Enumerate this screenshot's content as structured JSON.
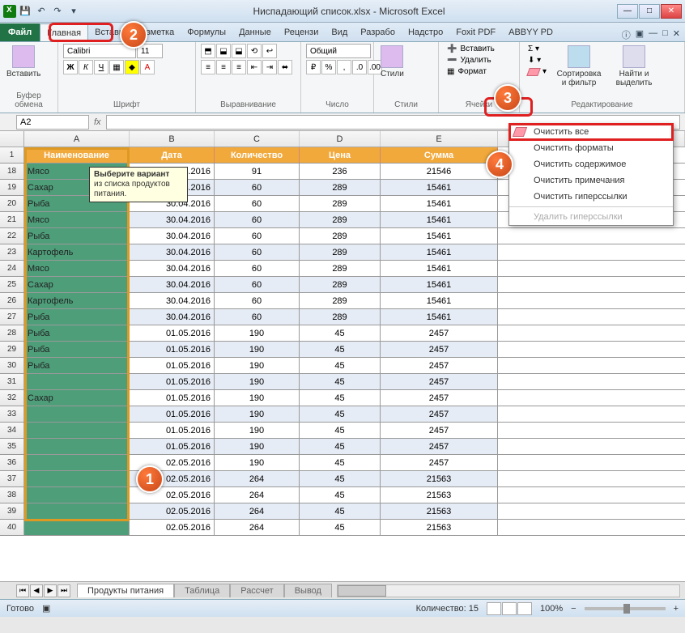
{
  "title": "Ниспадающий список.xlsx - Microsoft Excel",
  "tabs": {
    "file": "Файл",
    "list": [
      "Главная",
      "Вставк",
      "Разметка",
      "Формулы",
      "Данные",
      "Рецензи",
      "Вид",
      "Разрабо",
      "Надстро",
      "Foxit PDF",
      "ABBYY PD"
    ],
    "active": 0
  },
  "ribbon": {
    "clipboard": {
      "label": "Буфер обмена",
      "paste": "Вставить"
    },
    "font": {
      "label": "Шрифт",
      "name": "Calibri",
      "size": "11"
    },
    "alignment": {
      "label": "Выравнивание"
    },
    "number": {
      "label": "Число",
      "format": "Общий"
    },
    "styles": {
      "label": "Стили",
      "styles_btn": "Стили",
      "format_btn": "Формат"
    },
    "cells": {
      "label": "Ячейки",
      "insert": "Вставить",
      "delete": "Удалить",
      "format": "Формат"
    },
    "editing": {
      "label": "Редактирование",
      "sort": "Сортировка и фильтр",
      "find": "Найти и выделить"
    }
  },
  "name_box": "A2",
  "fx_label": "fx",
  "headers": [
    "Наименование",
    "Дата",
    "Количество",
    "Цена",
    "Сумма"
  ],
  "col_letters": [
    "A",
    "B",
    "C",
    "D",
    "E"
  ],
  "rows": [
    {
      "n": 18,
      "a": "Мясо",
      "b": "30.04.2016",
      "c": "91",
      "d": "236",
      "e": "21546"
    },
    {
      "n": 19,
      "a": "Сахар",
      "b": "30.04.2016",
      "c": "60",
      "d": "289",
      "e": "15461"
    },
    {
      "n": 20,
      "a": "Рыба",
      "b": "30.04.2016",
      "c": "60",
      "d": "289",
      "e": "15461"
    },
    {
      "n": 21,
      "a": "Мясо",
      "b": "30.04.2016",
      "c": "60",
      "d": "289",
      "e": "15461"
    },
    {
      "n": 22,
      "a": "Рыба",
      "b": "30.04.2016",
      "c": "60",
      "d": "289",
      "e": "15461"
    },
    {
      "n": 23,
      "a": "Картофель",
      "b": "30.04.2016",
      "c": "60",
      "d": "289",
      "e": "15461"
    },
    {
      "n": 24,
      "a": "Мясо",
      "b": "30.04.2016",
      "c": "60",
      "d": "289",
      "e": "15461"
    },
    {
      "n": 25,
      "a": "Сахар",
      "b": "30.04.2016",
      "c": "60",
      "d": "289",
      "e": "15461"
    },
    {
      "n": 26,
      "a": "Картофель",
      "b": "30.04.2016",
      "c": "60",
      "d": "289",
      "e": "15461"
    },
    {
      "n": 27,
      "a": "Рыба",
      "b": "30.04.2016",
      "c": "60",
      "d": "289",
      "e": "15461"
    },
    {
      "n": 28,
      "a": "Рыба",
      "b": "01.05.2016",
      "c": "190",
      "d": "45",
      "e": "2457"
    },
    {
      "n": 29,
      "a": "Рыба",
      "b": "01.05.2016",
      "c": "190",
      "d": "45",
      "e": "2457"
    },
    {
      "n": 30,
      "a": "Рыба",
      "b": "01.05.2016",
      "c": "190",
      "d": "45",
      "e": "2457"
    },
    {
      "n": 31,
      "a": "",
      "b": "01.05.2016",
      "c": "190",
      "d": "45",
      "e": "2457"
    },
    {
      "n": 32,
      "a": "Сахар",
      "b": "01.05.2016",
      "c": "190",
      "d": "45",
      "e": "2457"
    },
    {
      "n": 33,
      "a": "",
      "b": "01.05.2016",
      "c": "190",
      "d": "45",
      "e": "2457"
    },
    {
      "n": 34,
      "a": "",
      "b": "01.05.2016",
      "c": "190",
      "d": "45",
      "e": "2457"
    },
    {
      "n": 35,
      "a": "",
      "b": "01.05.2016",
      "c": "190",
      "d": "45",
      "e": "2457"
    },
    {
      "n": 36,
      "a": "",
      "b": "02.05.2016",
      "c": "190",
      "d": "45",
      "e": "2457"
    },
    {
      "n": 37,
      "a": "",
      "b": "02.05.2016",
      "c": "264",
      "d": "45",
      "e": "21563"
    },
    {
      "n": 38,
      "a": "",
      "b": "02.05.2016",
      "c": "264",
      "d": "45",
      "e": "21563"
    },
    {
      "n": 39,
      "a": "",
      "b": "02.05.2016",
      "c": "264",
      "d": "45",
      "e": "21563"
    },
    {
      "n": 40,
      "a": "",
      "b": "02.05.2016",
      "c": "264",
      "d": "45",
      "e": "21563"
    }
  ],
  "tooltip": {
    "title": "Выберите вариант",
    "body": "из списка продуктов питания."
  },
  "clear_menu": {
    "all": "Очистить все",
    "formats": "Очистить форматы",
    "contents": "Очистить содержимое",
    "comments": "Очистить примечания",
    "hyperlinks": "Очистить гиперссылки",
    "remove_hyper": "Удалить гиперссылки"
  },
  "sheets": [
    "Продукты питания",
    "Таблица",
    "Рассчет",
    "Вывод"
  ],
  "status": {
    "ready": "Готово",
    "count_label": "Количество: 15",
    "zoom": "100%",
    "minus": "−",
    "plus": "+"
  },
  "callouts": {
    "1": "1",
    "2": "2",
    "3": "3",
    "4": "4"
  }
}
